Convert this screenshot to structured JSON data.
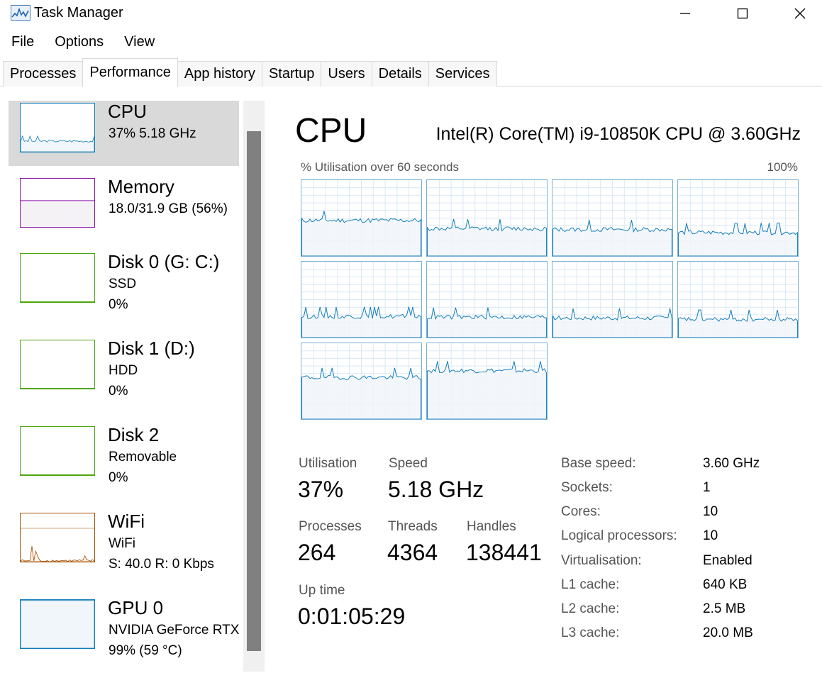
{
  "window": {
    "title": "Task Manager"
  },
  "menu": [
    "File",
    "Options",
    "View"
  ],
  "tabs": [
    {
      "label": "Processes",
      "active": false
    },
    {
      "label": "Performance",
      "active": true
    },
    {
      "label": "App history",
      "active": false
    },
    {
      "label": "Startup",
      "active": false
    },
    {
      "label": "Users",
      "active": false
    },
    {
      "label": "Details",
      "active": false
    },
    {
      "label": "Services",
      "active": false
    }
  ],
  "sidebar": [
    {
      "name": "CPU",
      "lines": [
        "37%  5.18 GHz"
      ],
      "color": "#117dbb",
      "fill": "#f1f6fa",
      "utilization": 0.37,
      "selected": true
    },
    {
      "name": "Memory",
      "lines": [
        "18.0/31.9 GB (56%)"
      ],
      "color": "#8b12ae",
      "fill": "#f4f2f4",
      "utilization": 0.56,
      "selected": false
    },
    {
      "name": "Disk 0 (G: C:)",
      "lines": [
        "SSD",
        "0%"
      ],
      "color": "#4da60c",
      "fill": "#eff7e9",
      "utilization": 0,
      "selected": false
    },
    {
      "name": "Disk 1 (D:)",
      "lines": [
        "HDD",
        "0%"
      ],
      "color": "#4da60c",
      "fill": "#eff7e9",
      "utilization": 0,
      "selected": false
    },
    {
      "name": "Disk 2",
      "lines": [
        "Removable",
        "0%"
      ],
      "color": "#4da60c",
      "fill": "#eff7e9",
      "utilization": 0,
      "selected": false
    },
    {
      "name": "WiFi",
      "lines": [
        "WiFi",
        "S: 40.0 R: 0 Kbps"
      ],
      "color": "#a74f01",
      "fill": "#fcf3eb",
      "utilization": 0.05,
      "selected": false
    },
    {
      "name": "GPU 0",
      "lines": [
        "NVIDIA GeForce RTX",
        "99%  (59 °C)"
      ],
      "color": "#117dbb",
      "fill": "#f1f6fa",
      "utilization": 0.99,
      "selected": false
    }
  ],
  "main": {
    "title": "CPU",
    "model": "Intel(R) Core(TM) i9-10850K CPU @ 3.60GHz",
    "graph_caption": "% Utilisation over 60 seconds",
    "graph_max": "100%",
    "core_count": 10,
    "core_levels": [
      0.47,
      0.36,
      0.35,
      0.31,
      0.28,
      0.27,
      0.26,
      0.24,
      0.55,
      0.64
    ],
    "colors": {
      "line": "#117dbb",
      "fill": "#f1f6fa",
      "grid": "#d9e8f5",
      "border": "#79afd6"
    },
    "stats": {
      "utilisation_label": "Utilisation",
      "utilisation": "37%",
      "speed_label": "Speed",
      "speed": "5.18 GHz",
      "processes_label": "Processes",
      "processes": "264",
      "threads_label": "Threads",
      "threads": "4364",
      "handles_label": "Handles",
      "handles": "138441",
      "uptime_label": "Up time",
      "uptime": "0:01:05:29"
    },
    "specs": [
      {
        "label": "Base speed:",
        "value": "3.60 GHz"
      },
      {
        "label": "Sockets:",
        "value": "1"
      },
      {
        "label": "Cores:",
        "value": "10"
      },
      {
        "label": "Logical processors:",
        "value": "10"
      },
      {
        "label": "Virtualisation:",
        "value": "Enabled"
      },
      {
        "label": "L1 cache:",
        "value": "640 KB"
      },
      {
        "label": "L2 cache:",
        "value": "2.5 MB"
      },
      {
        "label": "L3 cache:",
        "value": "20.0 MB"
      }
    ]
  }
}
